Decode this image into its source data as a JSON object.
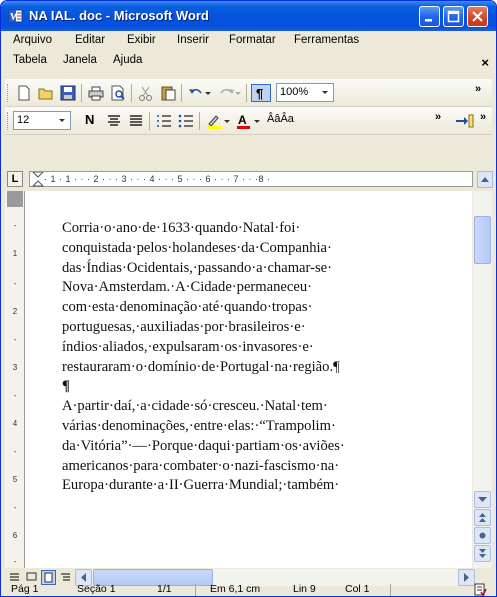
{
  "window": {
    "title": "NA IAL. doc - Microsoft Word"
  },
  "menu": {
    "row1": [
      "Arquivo",
      "Editar",
      "Exibir",
      "Inserir",
      "Formatar",
      "Ferramentas"
    ],
    "row2": [
      "Tabela",
      "Janela",
      "Ajuda"
    ],
    "close_glyph": "×"
  },
  "toolbar_standard": {
    "zoom": "100%",
    "chevron": "»"
  },
  "toolbar_formatting": {
    "font_size": "12",
    "bold": "N",
    "font_style_sample": "ÂâÂa"
  },
  "ruler": {
    "corner": "L",
    "marks": "· 1 · 1 · · · 2 · · · 3 · · · 4 · · · 5 · · · 6 · · · 7 · · ·8 ·",
    "vertical_marks": [
      "-",
      "1",
      "-",
      "2",
      "-",
      "3",
      "-",
      "4",
      "-",
      "5",
      "-",
      "6",
      "-"
    ]
  },
  "document": {
    "lines": [
      "Corria·o·ano·de·1633·quando·Natal·foi·",
      "conquistada·pelos·holandeses·da·Companhia·",
      "das·Índias·Ocidentais,·passando·a·chamar-se·",
      "Nova·Amsterdam.·A·Cidade·permaneceu·",
      "com·esta·denominação·até·quando·tropas·",
      "portuguesas,·auxiliadas·por·brasileiros·e·",
      "índios·aliados,·expulsaram·os·invasores·e·",
      "restauraram·o·domínio·de·Portugal·na·região.¶",
      "¶",
      "A·partir·daí,·a·cidade·só·cresceu.·Natal·tem·",
      "várias·denominações,·entre·elas:·“Trampolim·",
      "da·Vitória”·—·Porque·daqui·partiam·os·aviões·",
      "americanos·para·combater·o·nazi-fascismo·na·",
      "Europa·durante·a·II·Guerra·Mundial;·também·"
    ]
  },
  "statusbar": {
    "page": "Pág 1",
    "section": "Seção 1",
    "pages": "1/1",
    "position": "Em 6,1 cm",
    "line": "Lin 9",
    "column": "Col 1"
  }
}
